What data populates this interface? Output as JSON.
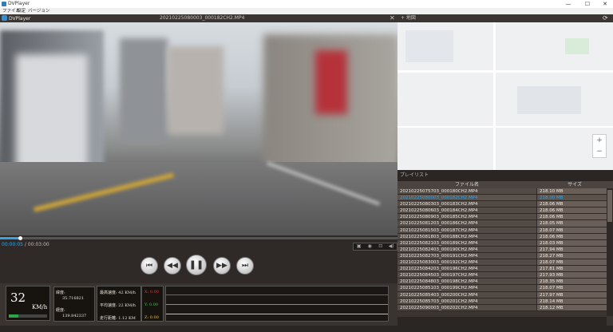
{
  "window": {
    "title": "DVPlayer",
    "minimize": "—",
    "maximize": "☐",
    "close": "✕"
  },
  "menu": {
    "file": "ファイル",
    "settings": "設定",
    "version": "バージョン"
  },
  "appbar": {
    "brand": "DVPlayer",
    "current_file": "20210225080003_000182CH2.MP4",
    "close_glyph": "✕",
    "map_label": "+ 地図",
    "refresh_glyph": "⟳"
  },
  "map": {
    "zoom_in": "+",
    "zoom_out": "−"
  },
  "player": {
    "progress": 0.05,
    "time_current": "00:00:05",
    "time_total": "/ 00:03:00",
    "tools": [
      "▣",
      "◉",
      "⊡",
      "◀)"
    ],
    "buttons": {
      "prev": "⏮",
      "rewind": "◀◀",
      "play_pause": "❚❚",
      "forward": "▶▶",
      "next": "⏭"
    }
  },
  "telemetry": {
    "speed": "32",
    "speed_unit": "KM/h",
    "speed_level": 0.25,
    "lat_label": "緯度:",
    "lat_value": "35.716821",
    "lon_label": "経度:",
    "lon_value": "139.842337",
    "max_speed": "最高速度: 42 KM/h",
    "avg_speed": "平均速度: 22 KM/h",
    "distance": "走行距離: 1.12 KM",
    "gx": "X: 0.00",
    "gy": "Y: 0.00",
    "gz": "Z: 0.00",
    "colors": {
      "x": "#d93a3a",
      "y": "#35c24b",
      "z": "#e3c24a"
    }
  },
  "playlist": {
    "title": "プレイリスト",
    "col_name": "ファイル名",
    "col_size": "サイズ",
    "rows": [
      {
        "name": "20210225075703_000180CH2.MP4",
        "size": "218.10 MB"
      },
      {
        "name": "20210225080003_000182CH2.MP4",
        "size": "218.00 MB",
        "selected": true
      },
      {
        "name": "20210225080303_000183CH2.MP4",
        "size": "218.06 MB"
      },
      {
        "name": "20210225080603_000184CH2.MP4",
        "size": "218.06 MB"
      },
      {
        "name": "20210225080903_000185CH2.MP4",
        "size": "218.06 MB"
      },
      {
        "name": "20210225081203_000186CH2.MP4",
        "size": "218.05 MB"
      },
      {
        "name": "20210225081503_000187CH2.MP4",
        "size": "218.07 MB"
      },
      {
        "name": "20210225081803_000188CH2.MP4",
        "size": "218.06 MB"
      },
      {
        "name": "20210225082103_000189CH2.MP4",
        "size": "218.03 MB"
      },
      {
        "name": "20210225082403_000190CH2.MP4",
        "size": "217.94 MB"
      },
      {
        "name": "20210225082703_000191CH2.MP4",
        "size": "218.27 MB"
      },
      {
        "name": "20210225083003_000192CH2.MP4",
        "size": "218.07 MB"
      },
      {
        "name": "20210225084203_000196CH2.MP4",
        "size": "217.81 MB"
      },
      {
        "name": "20210225084503_000197CH2.MP4",
        "size": "217.93 MB"
      },
      {
        "name": "20210225084803_000198CH2.MP4",
        "size": "218.35 MB"
      },
      {
        "name": "20210225085103_000199CH2.MP4",
        "size": "218.07 MB"
      },
      {
        "name": "20210225085403_000200CH2.MP4",
        "size": "217.97 MB"
      },
      {
        "name": "20210225085703_000201CH2.MP4",
        "size": "218.14 MB"
      },
      {
        "name": "20210225090003_000202CH2.MP4",
        "size": "218.12 MB"
      }
    ]
  }
}
